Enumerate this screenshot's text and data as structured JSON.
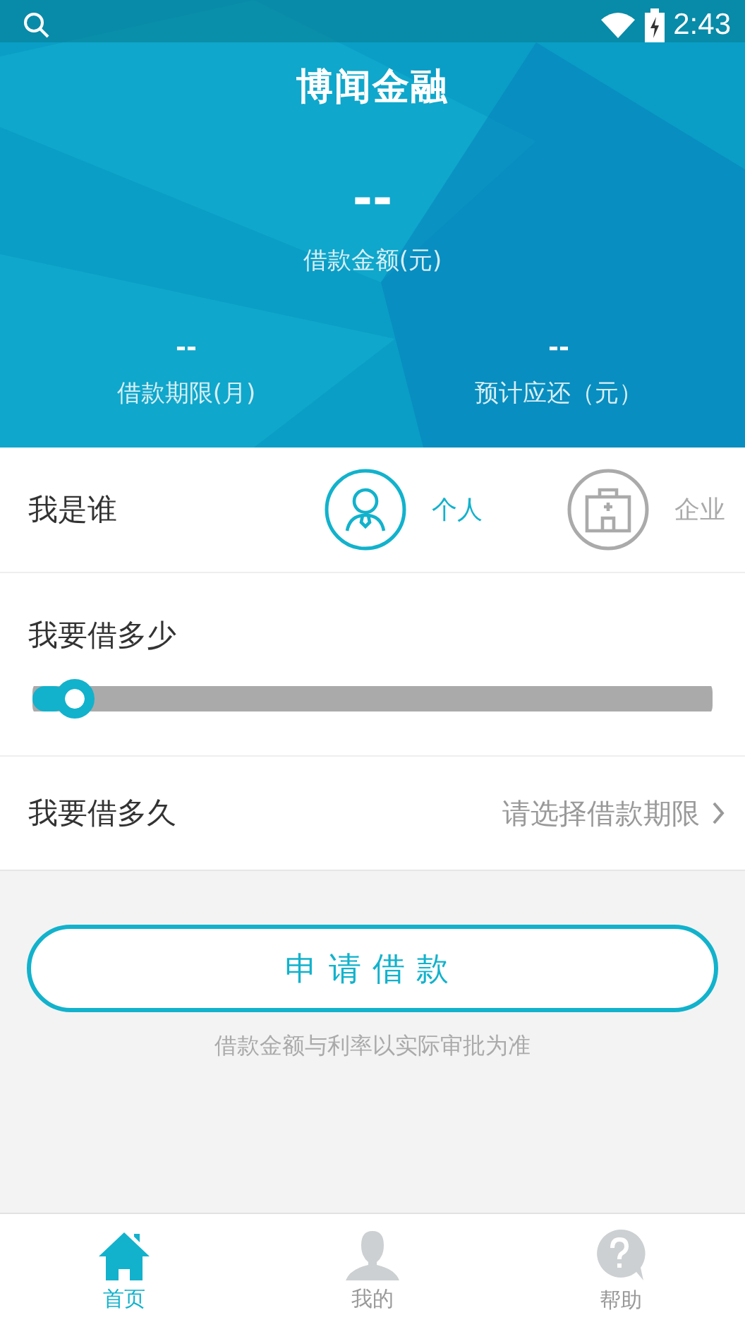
{
  "status_bar": {
    "time": "2:43"
  },
  "header": {
    "title": "博闻金融",
    "amount": {
      "value": "--",
      "label": "借款金额(元)"
    },
    "stats": [
      {
        "value": "--",
        "label": "借款期限(月)"
      },
      {
        "value": "--",
        "label": "预计应还（元）"
      }
    ]
  },
  "identity": {
    "label": "我是谁",
    "options": [
      {
        "kind": "person",
        "label": "个人",
        "selected": true
      },
      {
        "kind": "company",
        "label": "企业",
        "selected": false
      }
    ]
  },
  "amount_row": {
    "label": "我要借多少",
    "slider": {
      "level": 0.03
    }
  },
  "duration_row": {
    "label": "我要借多久",
    "placeholder": "请选择借款期限"
  },
  "apply_button": "申请借款",
  "note": "借款金额与利率以实际审批为准",
  "tabs": [
    {
      "kind": "home",
      "label": "首页",
      "selected": true
    },
    {
      "kind": "user",
      "label": "我的",
      "selected": false
    },
    {
      "kind": "help",
      "label": "帮助",
      "selected": false
    }
  ]
}
